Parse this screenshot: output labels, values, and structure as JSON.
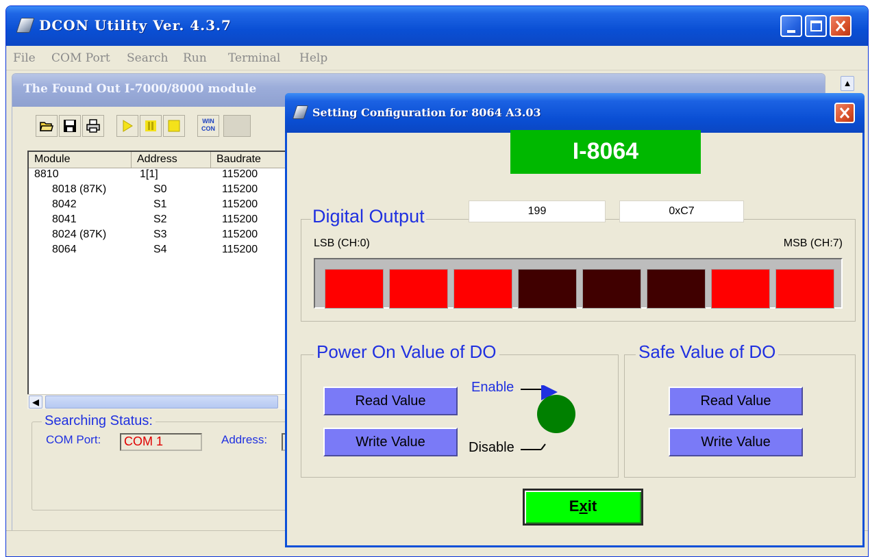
{
  "main_window": {
    "title": "DCON Utility Ver.  4.3.7",
    "caption_buttons": [
      "minimize",
      "maximize",
      "close"
    ]
  },
  "menu": [
    "File",
    "COM Port",
    "Search",
    "Run",
    "Terminal",
    "Help"
  ],
  "module_window": {
    "title": "The Found Out I-7000/8000 module",
    "toolbar": [
      "open-folder-icon",
      "save-icon",
      "print-icon",
      "run-icon",
      "pause-icon",
      "stop-icon",
      "wincon-icon"
    ],
    "wincon_label_top": "WIN",
    "wincon_label_bottom": "CON",
    "columns": [
      "Module",
      "Address",
      "Baudrate"
    ],
    "rows": [
      {
        "module": "8810",
        "address": "1[1]",
        "baudrate": "115200",
        "indent": false
      },
      {
        "module": "8018 (87K)",
        "address": "S0",
        "baudrate": "115200",
        "indent": true
      },
      {
        "module": "8042",
        "address": "S1",
        "baudrate": "115200",
        "indent": true
      },
      {
        "module": "8041",
        "address": "S2",
        "baudrate": "115200",
        "indent": true
      },
      {
        "module": "8024 (87K)",
        "address": "S3",
        "baudrate": "115200",
        "indent": true
      },
      {
        "module": "8064",
        "address": "S4",
        "baudrate": "115200",
        "indent": true
      }
    ],
    "status": {
      "legend": "Searching Status:",
      "com_label": "COM Port:",
      "com_value": "COM 1",
      "address_label": "Address:"
    }
  },
  "dialog": {
    "title": "Setting Configuration for 8064 A3.03",
    "module_banner": "I-8064",
    "digital_output": {
      "label": "Digital Output",
      "decimal_value": "199",
      "hex_value": "0xC7",
      "lsb_label": "LSB (CH:0)",
      "msb_label": "MSB (CH:7)",
      "channels": [
        1,
        1,
        1,
        0,
        0,
        0,
        1,
        1
      ],
      "on_color": "#ff0000",
      "off_color": "#400000"
    },
    "power_on": {
      "label": "Power On Value of DO",
      "read_button": "Read Value",
      "write_button": "Write Value",
      "enable_label": "Enable",
      "disable_label": "Disable",
      "toggle_state": "enable",
      "toggle_color": "#008000"
    },
    "safe_value": {
      "label": "Safe Value of DO",
      "read_button": "Read Value",
      "write_button": "Write Value"
    },
    "exit_button": "Exit"
  },
  "colors": {
    "titlebar_blue": "#0a4fd4",
    "banner_green": "#00b800",
    "exit_green": "#00ff00",
    "button_purple": "#7a7af7",
    "group_label_blue": "#1f30e0"
  }
}
